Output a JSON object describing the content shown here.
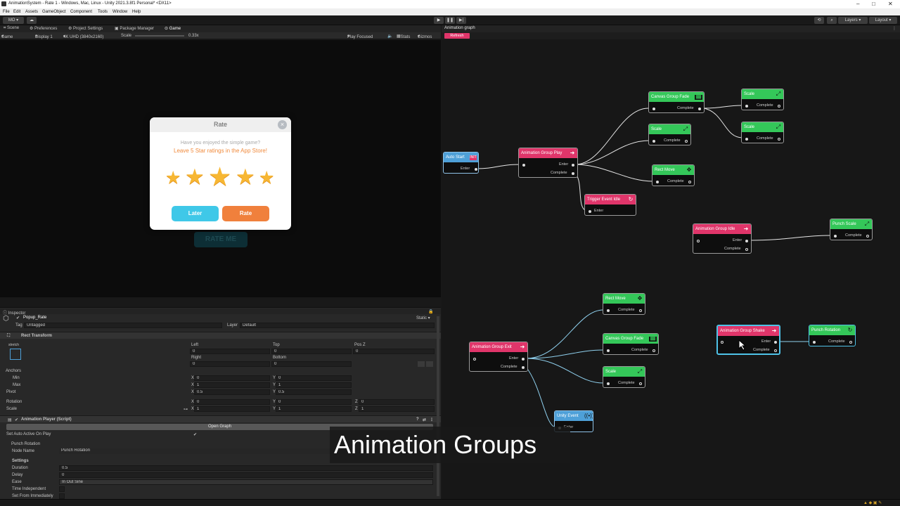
{
  "window": {
    "title": "AnimationSystem - Rate 1 - Windows, Mac, Linux - Unity 2021.3.8f1 Personal* <DX11>"
  },
  "menu": [
    "File",
    "Edit",
    "Assets",
    "GameObject",
    "Component",
    "Tools",
    "Window",
    "Help"
  ],
  "toolbar": {
    "account": "MO",
    "layers": "Layers",
    "layout": "Layout"
  },
  "tabs": [
    "Scene",
    "Preferences",
    "Project Settings",
    "Package Manager",
    "Game"
  ],
  "gamebar": {
    "mode": "Game",
    "display": "Display 1",
    "resolution": "4K UHD (3840x2160)",
    "scale_label": "Scale",
    "scale_value": "0.33x",
    "play_focused": "Play Focused",
    "stats": "Stats",
    "gizmos": "Gizmos"
  },
  "popup": {
    "title": "Rate",
    "question": "Have you enjoyed the simple game?",
    "subtitle": "Leave 5 Star ratings in the App Store!",
    "later": "Later",
    "rate": "Rate",
    "rating": 5,
    "background_button": "RATE ME"
  },
  "inspector": {
    "tab": "Inspector",
    "object_name": "Popup_Rate",
    "static": "Static",
    "tag_label": "Tag",
    "tag": "Untagged",
    "layer_label": "Layer",
    "layer": "Default",
    "rect_transform": "Rect Transform",
    "stretch": "stretch",
    "left_label": "Left",
    "left": "0",
    "top_label": "Top",
    "top": "0",
    "posz_label": "Pos Z",
    "posz": "0",
    "right_label": "Right",
    "right": "0",
    "bottom_label": "Bottom",
    "bottom": "0",
    "anchors": "Anchors",
    "min": "Min",
    "max": "Max",
    "pivot": "Pivot",
    "min_x": "0",
    "min_y": "0",
    "max_x": "1",
    "max_y": "1",
    "pivot_x": "0.5",
    "pivot_y": "0.5",
    "rotation": "Rotation",
    "rot_x": "0",
    "rot_y": "0",
    "rot_z": "0",
    "scale": "Scale",
    "scale_x": "1",
    "scale_y": "1",
    "scale_z": "1",
    "x": "X",
    "y": "Y",
    "z": "Z",
    "script_title": "Animation Player (Script)",
    "open_graph": "Open Graph",
    "auto_active": "Set Auto Active On Play",
    "punch_rotation": "Punch Rotation",
    "node_name_label": "Node Name",
    "node_name": "Punch Rotation",
    "settings": "Settings",
    "duration_label": "Duration",
    "duration": "0.5",
    "delay_label": "Delay",
    "delay": "0",
    "ease_label": "Ease",
    "ease": "In Out Sine",
    "time_independent": "Time Independent",
    "set_from_immediately": "Set From Immediately"
  },
  "graph": {
    "tab": "Animation graph",
    "refresh": "Refresh"
  },
  "nodes": {
    "auto_start": {
      "title": "Auto Start",
      "ports": [
        "Enter"
      ]
    },
    "group_play": {
      "title": "Animation Group Play",
      "ports": [
        "Enter",
        "Complete"
      ]
    },
    "trigger_idle": {
      "title": "Trigger Event Idle",
      "ports": [
        "Enter"
      ]
    },
    "canvas_fade1": {
      "title": "Canvas Group Fade",
      "ports": [
        "Complete"
      ]
    },
    "scale1": {
      "title": "Scale",
      "ports": [
        "Complete"
      ]
    },
    "scale2": {
      "title": "Scale",
      "ports": [
        "Complete"
      ]
    },
    "scale3": {
      "title": "Scale",
      "ports": [
        "Complete"
      ]
    },
    "rect_move1": {
      "title": "Rect Move",
      "ports": [
        "Complete"
      ]
    },
    "group_idle": {
      "title": "Animation Group Idle",
      "ports": [
        "Enter",
        "Complete"
      ]
    },
    "punch_scale": {
      "title": "Punch Scale",
      "ports": [
        "Complete"
      ]
    },
    "group_exit": {
      "title": "Animation Group Exit",
      "ports": [
        "Enter",
        "Complete"
      ]
    },
    "rect_move2": {
      "title": "Rect Move",
      "ports": [
        "Complete"
      ]
    },
    "canvas_fade2": {
      "title": "Canvas Group Fade",
      "ports": [
        "Complete"
      ]
    },
    "scale4": {
      "title": "Scale",
      "ports": [
        "Complete"
      ]
    },
    "unity_event": {
      "title": "Unity Event",
      "ports": [
        "Enter"
      ]
    },
    "group_shake": {
      "title": "Animation Group Shake",
      "ports": [
        "Enter",
        "Complete"
      ]
    },
    "punch_rotation": {
      "title": "Punch Rotation",
      "ports": [
        "Complete"
      ]
    }
  },
  "caption": "Animation Groups"
}
